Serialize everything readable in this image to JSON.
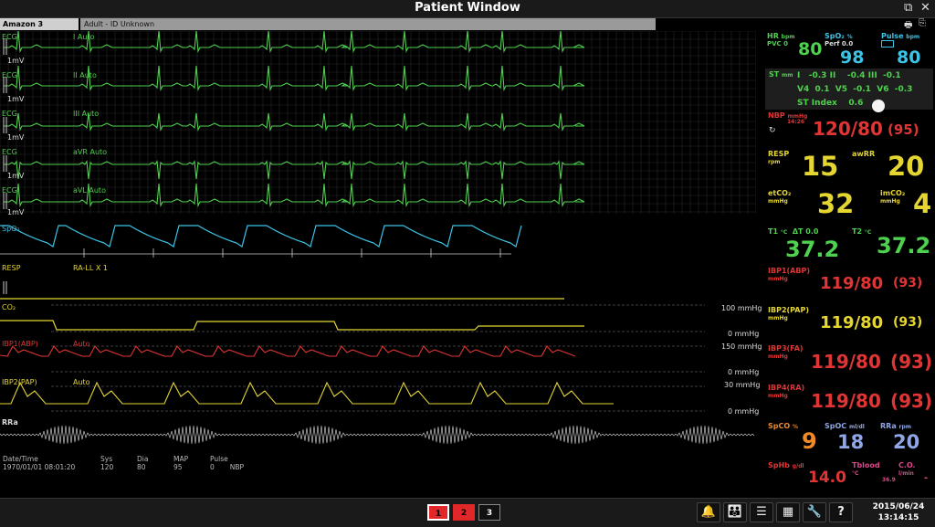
{
  "window": {
    "title": "Patient Window",
    "restore_glyph": "⧉",
    "close_glyph": "✕"
  },
  "bed": {
    "label": "Amazon 3"
  },
  "patient": {
    "label": "Adult - ID Unknown"
  },
  "waves": {
    "ecg": [
      {
        "name": "ECG",
        "lead": "I",
        "mode": "Auto",
        "scale": "1mV"
      },
      {
        "name": "ECG",
        "lead": "II",
        "mode": "Auto",
        "scale": "1mV"
      },
      {
        "name": "ECG",
        "lead": "III",
        "mode": "Auto",
        "scale": "1mV"
      },
      {
        "name": "ECG",
        "lead": "aVR",
        "mode": "Auto",
        "scale": "1mV"
      },
      {
        "name": "ECG",
        "lead": "aVL",
        "mode": "Auto",
        "scale": "1mV"
      }
    ],
    "spo2": {
      "name": "SpO₂"
    },
    "resp": {
      "name": "RESP",
      "lead": "RA-LL X 1"
    },
    "co2": {
      "name": "CO₂",
      "top": "100 mmHg",
      "bottom": "0 mmHg"
    },
    "ibp1": {
      "name": "IBP1(ABP)",
      "mode": "Auto",
      "top": "150 mmHg",
      "bottom": "0 mmHg"
    },
    "ibp2": {
      "name": "IBP2(PAP)",
      "mode": "Auto",
      "top": "30 mmHg",
      "bottom": "0 mmHg"
    },
    "rra": {
      "name": "RRa"
    }
  },
  "history": {
    "headers": [
      "Date/Time",
      "Sys",
      "Dia",
      "MAP",
      "Pulse",
      ""
    ],
    "row": [
      "1970/01/01 08:01:20",
      "120",
      "80",
      "95",
      "0",
      "NBP"
    ]
  },
  "params": {
    "hr": {
      "label": "HR",
      "unit": "bpm",
      "sub": "PVC",
      "sub_value": "0",
      "value": "80"
    },
    "spo2": {
      "label": "SpO₂",
      "unit": "%",
      "sub": "Perf 0.0",
      "value": "98"
    },
    "pulse": {
      "label": "Pulse",
      "unit": "bpm",
      "value": "80"
    },
    "st": {
      "label": "ST",
      "unit": "mm",
      "rows": [
        [
          "I",
          "-0.3",
          "II",
          "-0.4",
          "III",
          "-0.1"
        ],
        [
          "V4",
          "0.1",
          "V5",
          "-0.1",
          "V6",
          "-0.3"
        ]
      ],
      "index_label": "ST Index",
      "index_value": "0.6"
    },
    "nbp": {
      "label": "NBP",
      "unit": "mmHg",
      "time": "14:26",
      "value": "120/80",
      "mean": "(95)"
    },
    "resp": {
      "label": "RESP",
      "unit": "rpm",
      "value": "15"
    },
    "awrr": {
      "label": "awRR",
      "value": "20"
    },
    "etco2": {
      "label": "etCO₂",
      "unit": "mmHg",
      "value": "32"
    },
    "imco2": {
      "label": "imCO₂",
      "unit": "mmHg",
      "value": "4"
    },
    "t1": {
      "label": "T1",
      "unit": "°C",
      "delta": "ΔT 0.0",
      "value": "37.2"
    },
    "t2": {
      "label": "T2",
      "unit": "°C",
      "value": "37.2"
    },
    "ibp1": {
      "label": "IBP1(ABP)",
      "unit": "mmHg",
      "value": "119/80",
      "mean": "(93)"
    },
    "ibp2": {
      "label": "IBP2(PAP)",
      "unit": "mmHg",
      "value": "119/80",
      "mean": "(93)"
    },
    "ibp3": {
      "label": "IBP3(FA)",
      "unit": "mmHg",
      "value": "119/80",
      "mean": "(93)"
    },
    "ibp4": {
      "label": "IBP4(RA)",
      "unit": "mmHg",
      "value": "119/80",
      "mean": "(93)"
    },
    "spco": {
      "label": "SpCO",
      "unit": "%",
      "value": "9"
    },
    "spoc": {
      "label": "SpOC",
      "unit": "ml/dl",
      "value": "18"
    },
    "rra": {
      "label": "RRa",
      "unit": "rpm",
      "value": "20"
    },
    "sphb": {
      "label": "SpHb",
      "unit": "g/dl",
      "value": "14.0"
    },
    "tblood": {
      "label": "Tblood",
      "unit": "°C",
      "value": "36.9"
    },
    "co": {
      "label": "C.O.",
      "unit": "l/min",
      "value": "-"
    }
  },
  "footer": {
    "screens": [
      "1",
      "2",
      "3"
    ],
    "tools": {
      "alarm": "🔔",
      "patients": "👪",
      "list": "☰",
      "layout": "▦",
      "setup": "🔧",
      "help": "?"
    },
    "date": "2015/06/24",
    "time": "13:14:15"
  },
  "colors": {
    "ecg": "#4ed14e",
    "spo2": "#3cc4e6",
    "resp": "#e4d531",
    "ibp_red": "#e03535",
    "grid": "#262626"
  }
}
